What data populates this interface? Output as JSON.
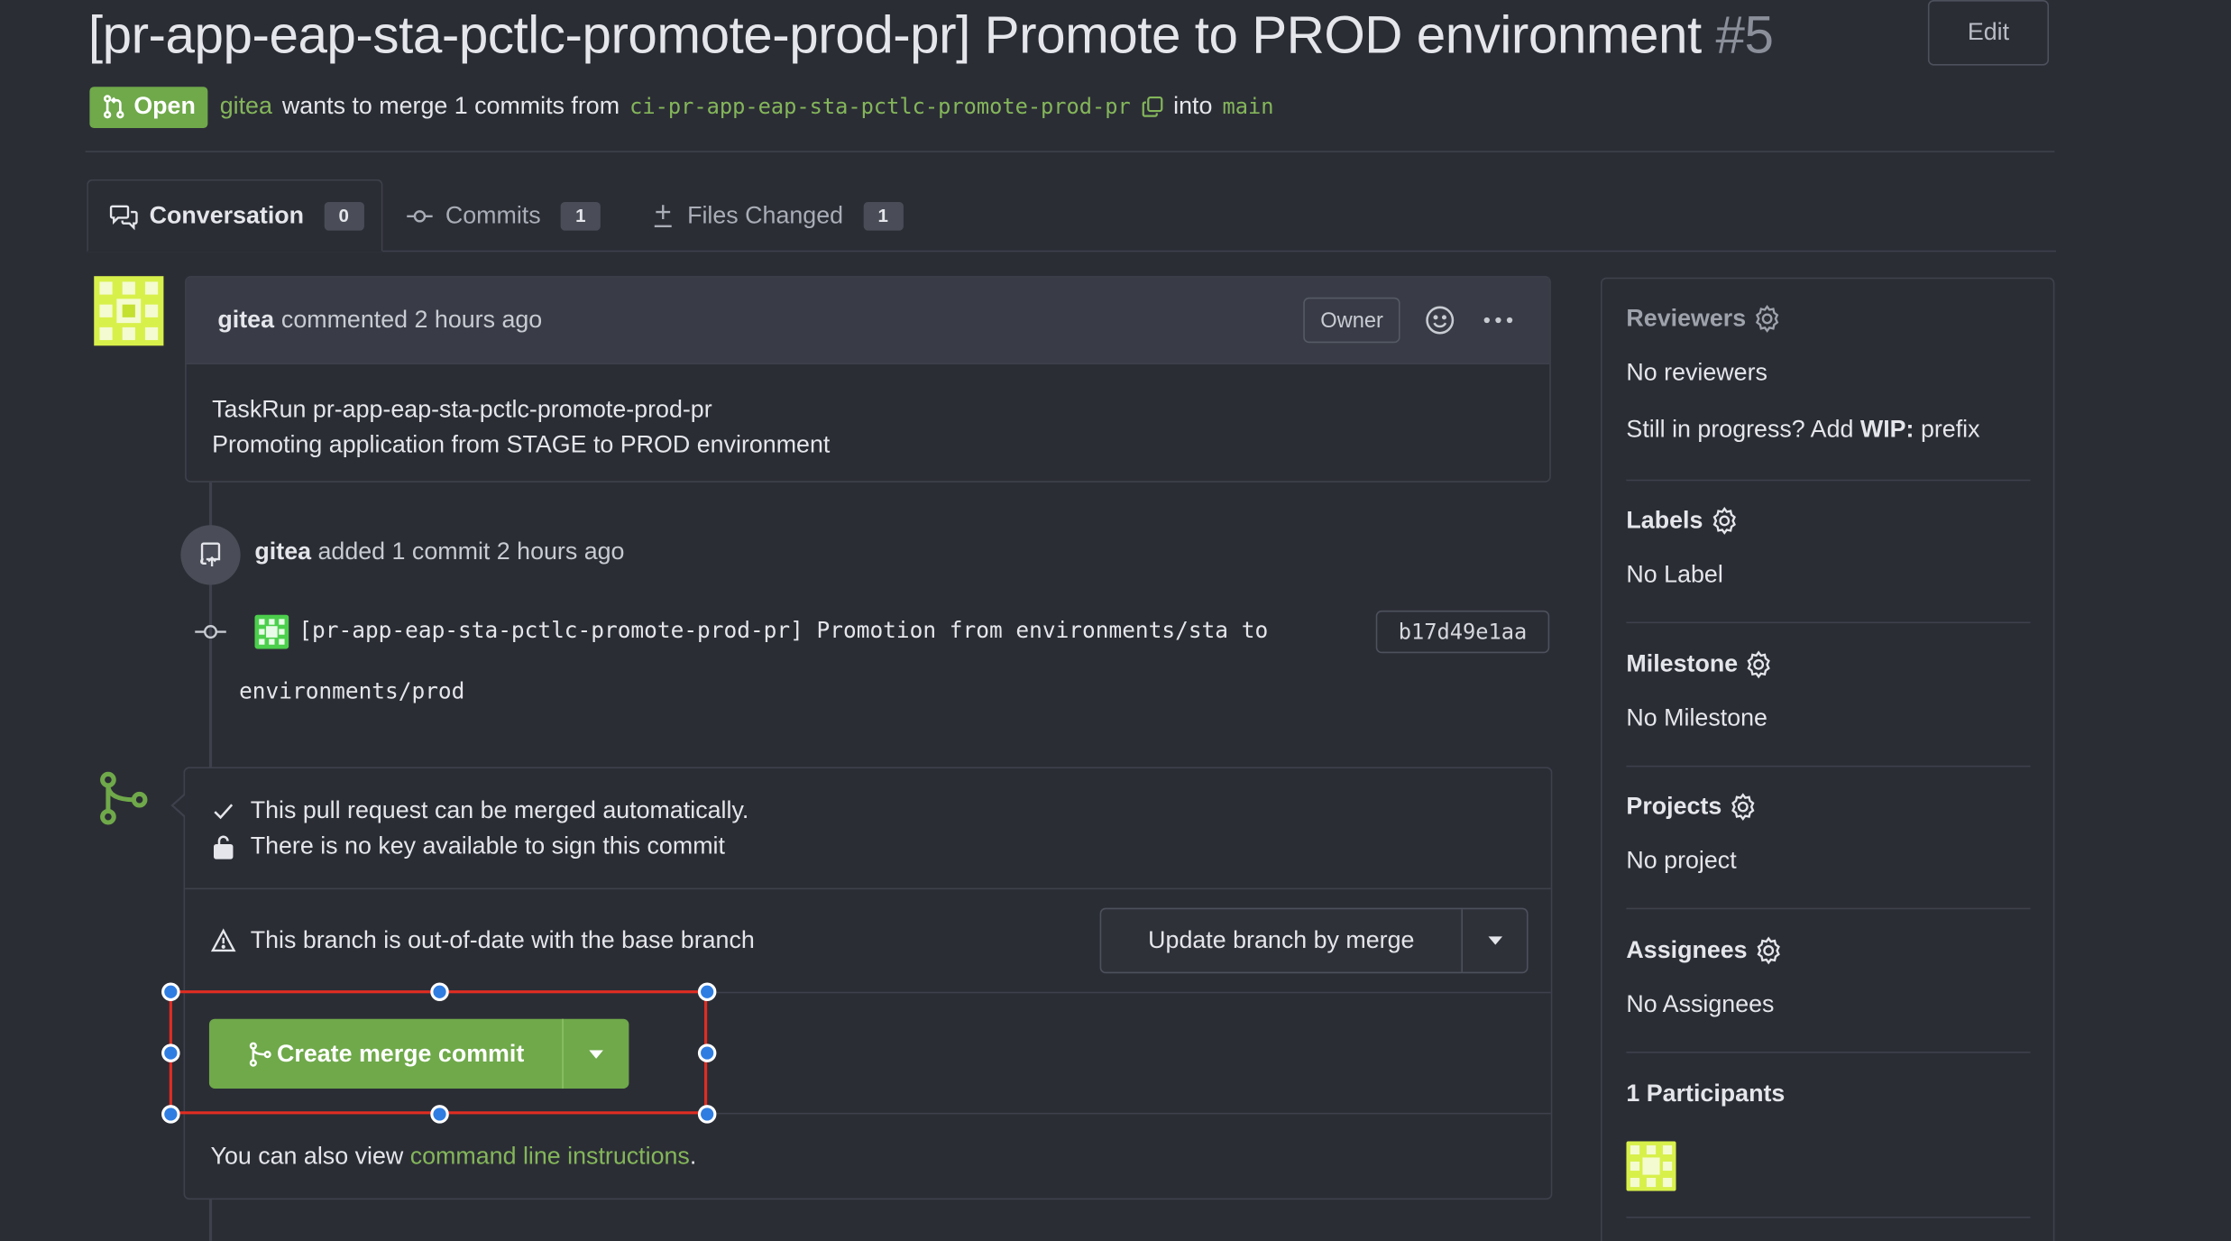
{
  "header": {
    "title": "[pr-app-eap-sta-pctlc-promote-prod-pr] Promote to PROD environment",
    "number": "#5",
    "edit_label": "Edit"
  },
  "status": {
    "badge": "Open",
    "author": "gitea",
    "wants_text": "wants to merge 1 commits from",
    "head_branch": "ci-pr-app-eap-sta-pctlc-promote-prod-pr",
    "into_text": "into",
    "base_branch": "main"
  },
  "tabs": [
    {
      "label": "Conversation",
      "count": "0",
      "icon": "conversation-icon"
    },
    {
      "label": "Commits",
      "count": "1",
      "icon": "commit-icon"
    },
    {
      "label": "Files Changed",
      "count": "1",
      "icon": "diff-icon"
    }
  ],
  "comment": {
    "author": "gitea",
    "action": "commented",
    "time": "2 hours ago",
    "role": "Owner",
    "body_line1": "TaskRun pr-app-eap-sta-pctlc-promote-prod-pr",
    "body_line2": "Promoting application from STAGE to PROD environment"
  },
  "push_event": {
    "author": "gitea",
    "text": "added 1 commit 2 hours ago"
  },
  "commit": {
    "message_line1": "[pr-app-eap-sta-pctlc-promote-prod-pr] Promotion from environments/sta to",
    "message_line2": "environments/prod",
    "sha": "b17d49e1aa"
  },
  "merge": {
    "auto_merge": "This pull request can be merged automatically.",
    "no_key": "There is no key available to sign this commit",
    "out_of_date": "This branch is out-of-date with the base branch",
    "update_button": "Update branch by merge",
    "merge_button": "Create merge commit",
    "also_text": "You can also view",
    "cli_link": "command line instructions",
    "period": "."
  },
  "sidebar": {
    "reviewers_title": "Reviewers",
    "reviewers_value": "No reviewers",
    "wip_prefix_text": "Still in progress? Add",
    "wip_bold": "WIP:",
    "wip_suffix": "prefix",
    "labels_title": "Labels",
    "labels_value": "No Label",
    "milestone_title": "Milestone",
    "milestone_value": "No Milestone",
    "projects_title": "Projects",
    "projects_value": "No project",
    "assignees_title": "Assignees",
    "assignees_value": "No Assignees",
    "participants_title": "1 Participants"
  },
  "colors": {
    "accent_green": "#6fa94a",
    "link_green": "#84b65a",
    "background": "#2b2d35",
    "selection_red": "#e02d22",
    "handle_blue": "#2f7de1"
  }
}
